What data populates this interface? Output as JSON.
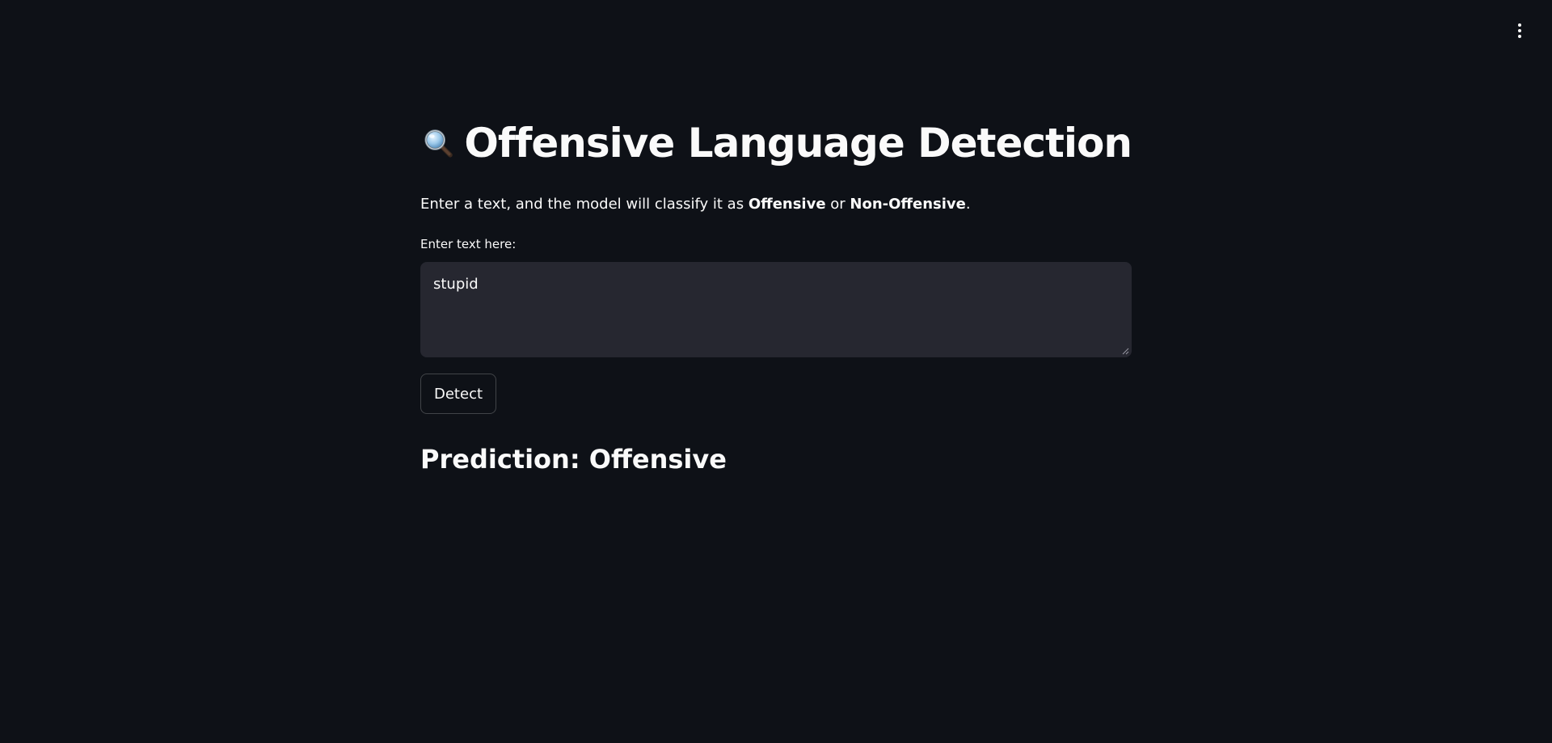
{
  "app": {
    "menu_icon": "vertical-ellipsis-icon"
  },
  "header": {
    "icon": "magnifying-glass-icon",
    "title": "Offensive Language Detection"
  },
  "description": {
    "prefix": "Enter a text, and the model will classify it as ",
    "label_offensive": "Offensive",
    "connector": " or ",
    "label_non_offensive": "Non-Offensive",
    "suffix": "."
  },
  "input": {
    "label": "Enter text here:",
    "value": "stupid"
  },
  "actions": {
    "detect_label": "Detect"
  },
  "result": {
    "prediction_text": "Prediction: Offensive"
  },
  "colors": {
    "background": "#0e1117",
    "input_background": "#262730",
    "text": "#fafafa"
  }
}
